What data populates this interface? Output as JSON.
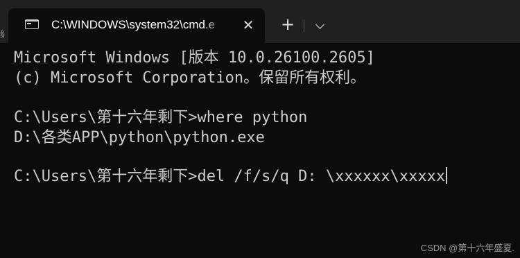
{
  "window": {
    "tab_title": "C:\\WINDOWS\\system32\\cmd.e",
    "close_glyph": "✕",
    "new_tab_glyph": "+",
    "left_edge_text": "编"
  },
  "console": {
    "lines": [
      "Microsoft Windows [版本 10.0.26100.2605]",
      "(c) Microsoft Corporation。保留所有权利。",
      "",
      "C:\\Users\\第十六年剩下>where python",
      "D:\\各类APP\\python\\python.exe",
      "",
      "C:\\Users\\第十六年剩下>del /f/s/q D: \\xxxxxx\\xxxxx"
    ]
  },
  "watermark": "CSDN @第十六年盛夏."
}
